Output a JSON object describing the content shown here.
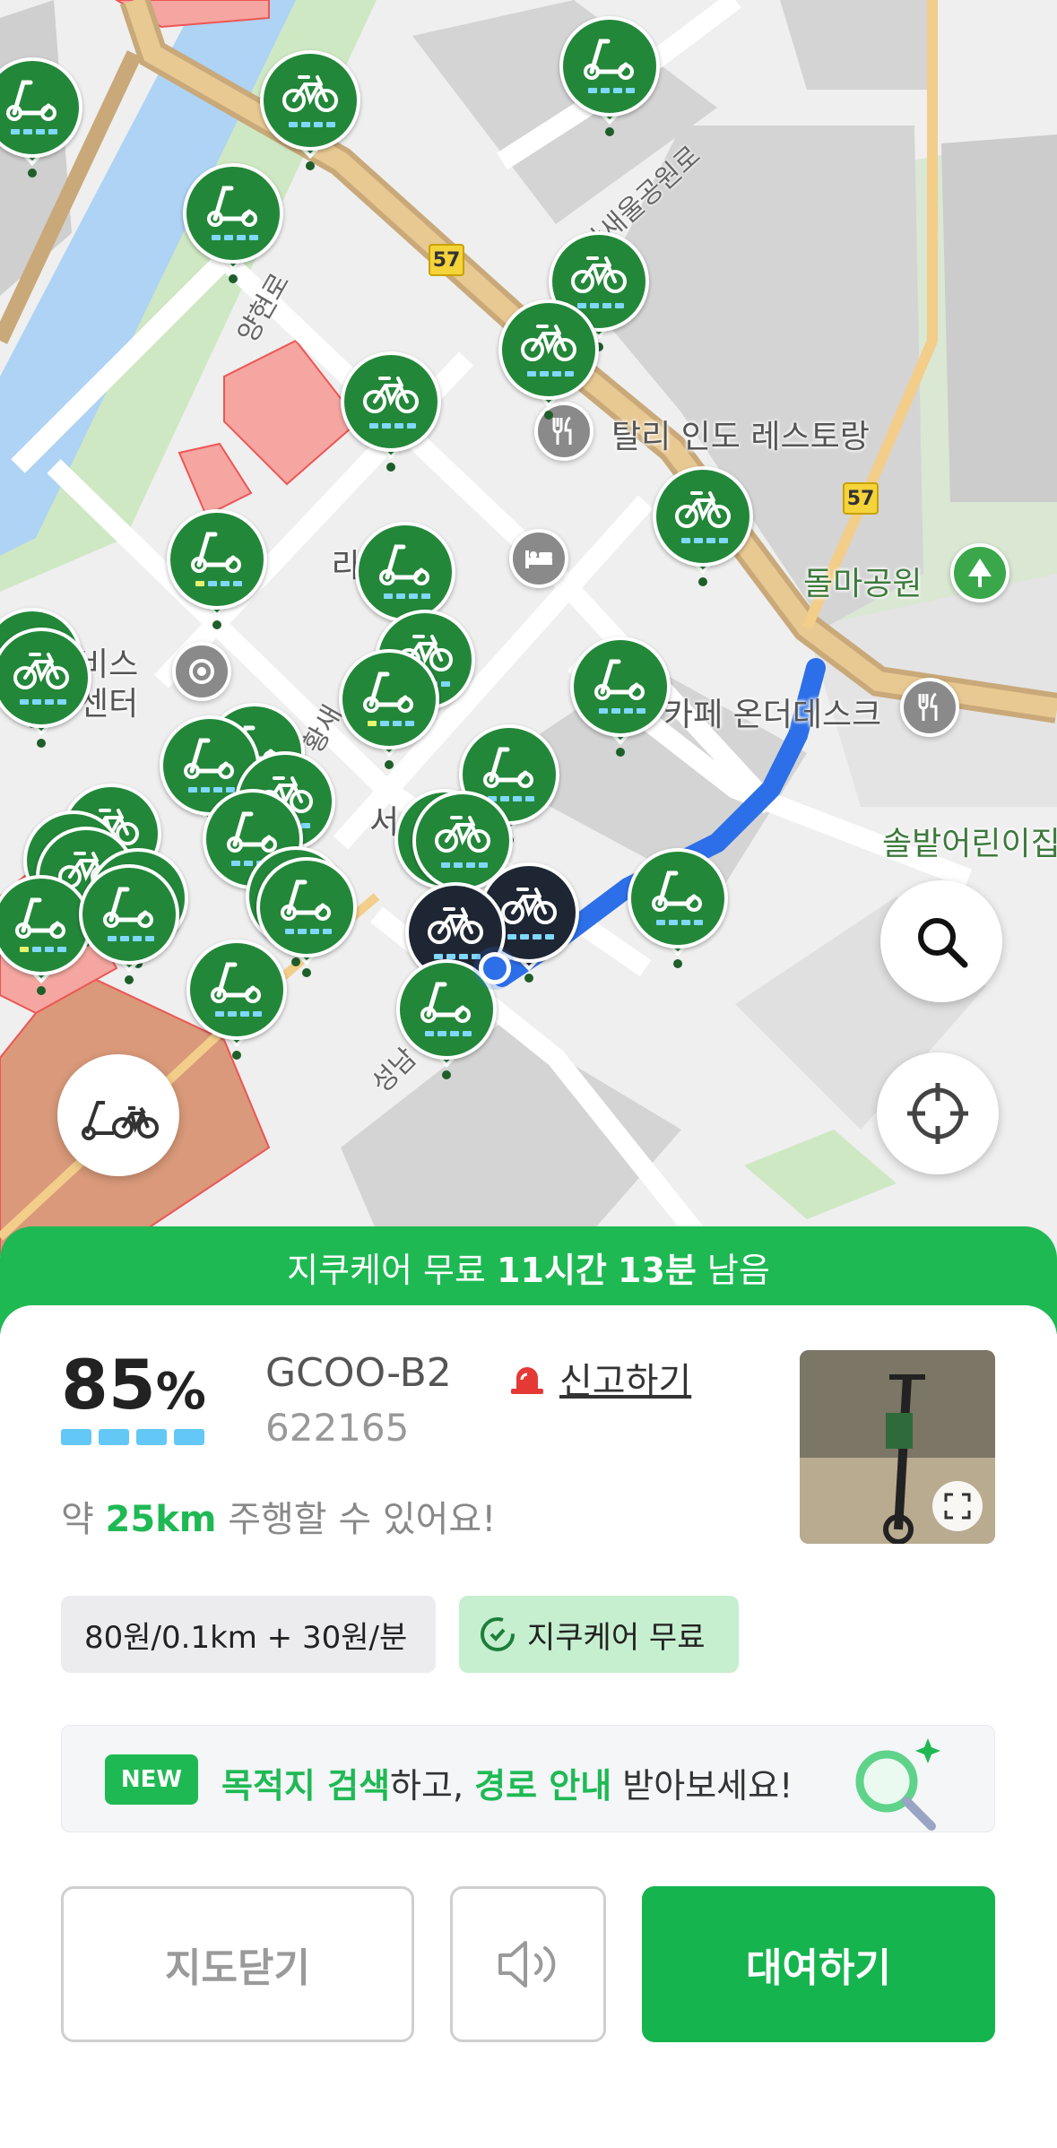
{
  "map": {
    "labels": {
      "restaurant_tali": "탈리 인도 레스토랑",
      "park": "돌마공원",
      "cafe": "카페 온더데스크",
      "kindergarten": "솔밭어린이집",
      "hotel_partial": "라       호텔",
      "service_line1": "비스",
      "service_line2": "센터",
      "road_yangheon": "양현로",
      "road_park": "황새울공원로",
      "road_hwang": "황새",
      "road_seong": "성남",
      "road_seo": "서"
    },
    "route_number": "57",
    "buttons": {
      "search_icon": "search-icon",
      "locate_icon": "crosshair-icon",
      "vehicle_filter_icon": "scooter-bike-icon"
    },
    "colors": {
      "pin": "#23873a",
      "selected_pin": "#1f2633",
      "route": "#2c6fe8"
    }
  },
  "care_banner": {
    "prefix": "지쿠케어 무료",
    "hours": "11시간",
    "minutes": "13분",
    "suffix": "남음"
  },
  "vehicle": {
    "battery_value": "85",
    "battery_unit": "%",
    "model": "GCOO-B2",
    "serial": "622165",
    "report_label": "신고하기",
    "range_prefix": "약",
    "range_value": "25km",
    "range_suffix": "주행할 수 있어요!"
  },
  "chips": {
    "price": "80원/0.1km + 30원/분",
    "care": "지쿠케어 무료"
  },
  "promo": {
    "badge": "NEW",
    "part1": "목적지 검색",
    "part2": "하고, ",
    "part3": "경로 안내",
    "part4": " 받아보세요!"
  },
  "buttons": {
    "close_map": "지도닫기",
    "rent": "대여하기"
  },
  "theme": {
    "accent": "#1fb954"
  }
}
